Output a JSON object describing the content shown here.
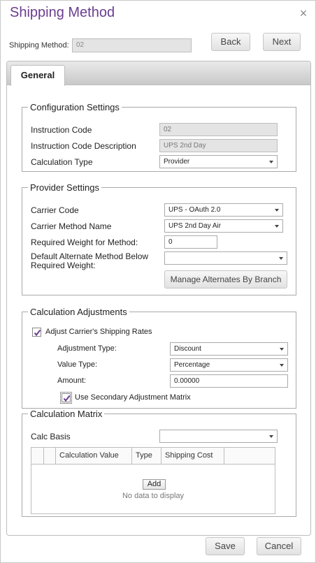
{
  "dialog": {
    "title": "Shipping Method",
    "close_glyph": "×",
    "shipping_method_label": "Shipping Method:",
    "shipping_method_value": "02",
    "back_label": "Back",
    "next_label": "Next"
  },
  "tabs": [
    {
      "label": "General"
    }
  ],
  "configuration": {
    "legend": "Configuration Settings",
    "instruction_code_label": "Instruction Code",
    "instruction_code_value": "02",
    "instruction_desc_label": "Instruction Code Description",
    "instruction_desc_value": "UPS 2nd Day",
    "calc_type_label": "Calculation Type",
    "calc_type_value": "Provider"
  },
  "provider": {
    "legend": "Provider Settings",
    "carrier_code_label": "Carrier Code",
    "carrier_code_value": "UPS - OAuth 2.0",
    "carrier_method_label": "Carrier Method Name",
    "carrier_method_value": "UPS 2nd Day Air",
    "required_weight_label": "Required Weight for Method:",
    "required_weight_value": "0",
    "default_alt_label_1": "Default Alternate Method Below",
    "default_alt_label_2": "Required Weight:",
    "default_alt_value": "",
    "manage_alternates_label": "Manage Alternates By Branch"
  },
  "adjustments": {
    "legend": "Calculation Adjustments",
    "adjust_rates_label": "Adjust Carrier's Shipping Rates",
    "adjust_rates_checked": true,
    "adjustment_type_label": "Adjustment Type:",
    "adjustment_type_value": "Discount",
    "value_type_label": "Value Type:",
    "value_type_value": "Percentage",
    "amount_label": "Amount:",
    "amount_value": "0.00000",
    "secondary_matrix_label": "Use Secondary Adjustment Matrix",
    "secondary_matrix_checked": true
  },
  "matrix": {
    "legend": "Calculation Matrix",
    "calc_basis_label": "Calc Basis",
    "calc_basis_value": "",
    "columns": [
      "Calculation Value",
      "Type",
      "Shipping Cost"
    ],
    "add_label": "Add",
    "empty_text": "No data to display"
  },
  "footer": {
    "save_label": "Save",
    "cancel_label": "Cancel"
  },
  "colors": {
    "title": "#6a3d8f",
    "readonly_bg": "#e4e4e4"
  }
}
